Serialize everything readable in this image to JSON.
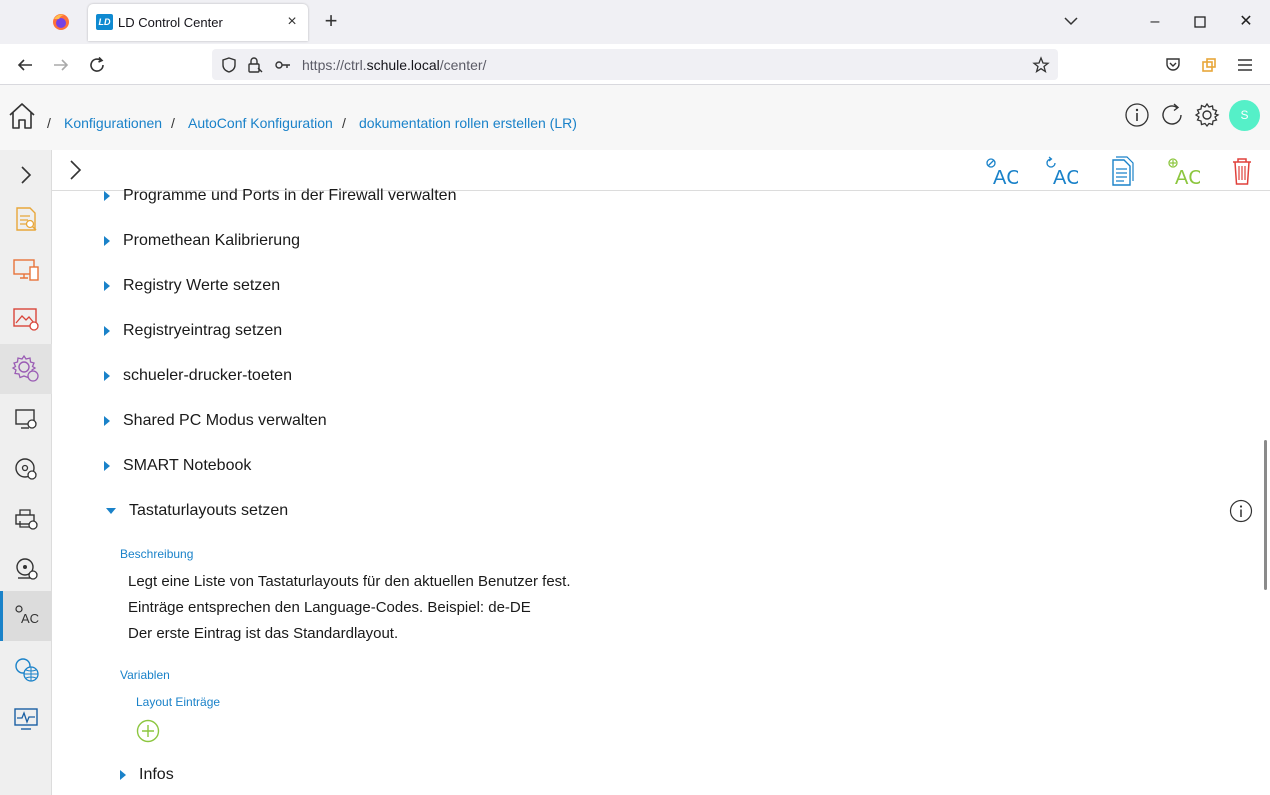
{
  "browser": {
    "tab_title": "LD Control Center",
    "tab_favicon_text": "LD",
    "url_host_prefix": "https://ctrl.",
    "url_host": "schule.local",
    "url_path": "/center/"
  },
  "header": {
    "avatar_initial": "S",
    "breadcrumbs": [
      "Konfigurationen",
      "AutoConf Konfiguration",
      "dokumentation rollen erstellen (LR)"
    ],
    "separator": "/"
  },
  "toolbar": {
    "icons": [
      "autoconf-disable-icon",
      "autoconf-refresh-icon",
      "document-icon",
      "autoconf-add-icon",
      "trash-icon"
    ],
    "ac_text": "AC"
  },
  "sidebar": {
    "ac_text": "AC",
    "items": [
      "expand-icon",
      "report-icon",
      "devices-icon",
      "image-settings-icon",
      "settings-roles-icon",
      "computer-settings-icon",
      "disk-settings-icon",
      "printer-settings-icon",
      "drive-settings-icon",
      "autoconf-icon",
      "network-settings-icon",
      "monitor-icon"
    ]
  },
  "list": {
    "items": [
      "Programme und Ports in der Firewall verwalten",
      "Promethean Kalibrierung",
      "Registry Werte setzen",
      "Registryeintrag setzen",
      "schueler-drucker-toeten",
      "Shared PC Modus verwalten",
      "SMART Notebook"
    ],
    "expanded": {
      "title": "Tastaturlayouts setzen",
      "description_label": "Beschreibung",
      "description_lines": [
        "Legt eine Liste von Tastaturlayouts für den aktuellen Benutzer fest.",
        "Einträge entsprechen den Language-Codes. Beispiel: de-DE",
        "Der erste Eintrag ist das Standardlayout."
      ],
      "variables_label": "Variablen",
      "variable_name": "Layout Einträge",
      "infos_label": "Infos"
    }
  },
  "colors": {
    "accent": "#1a82c9",
    "avatar": "#55f0c8",
    "delete": "#e0413b",
    "add": "#8cc63f"
  }
}
